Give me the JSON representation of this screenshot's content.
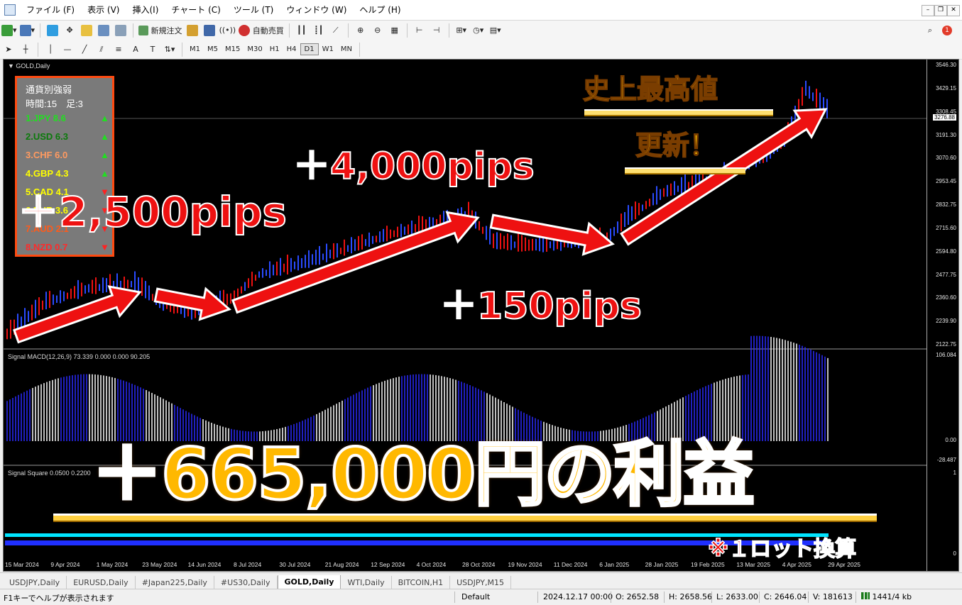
{
  "menu": [
    "ファイル (F)",
    "表示 (V)",
    "挿入(I)",
    "チャート (C)",
    "ツール (T)",
    "ウィンドウ (W)",
    "ヘルプ (H)"
  ],
  "toolbar": {
    "new_order": "新規注文",
    "auto_trade": "自動売買",
    "notification_count": "1"
  },
  "timeframes": [
    "M1",
    "M5",
    "M15",
    "M30",
    "H1",
    "H4",
    "D1",
    "W1",
    "MN"
  ],
  "active_timeframe": "D1",
  "chart": {
    "symbol_label": "GOLD,Daily",
    "price_ticks": [
      "3546.30",
      "3429.15",
      "3308.45",
      "3191.30",
      "3070.60",
      "2953.45",
      "2832.75",
      "2715.60",
      "2594.80",
      "2477.75",
      "2360.60",
      "2239.90",
      "2122.75"
    ],
    "current_price": "3276.88",
    "macd_label": "Signal MACD(12,26,9) 73.339 0.000 0.000 90.205",
    "macd_ticks": [
      "106.084",
      "0.00",
      "-28.487"
    ],
    "square_label": "Signal Square 0.0500 0.2200",
    "square_ticks": [
      "1",
      "0"
    ],
    "dates": [
      "15 Mar 2024",
      "9 Apr 2024",
      "1 May 2024",
      "23 May 2024",
      "14 Jun 2024",
      "8 Jul 2024",
      "30 Jul 2024",
      "21 Aug 2024",
      "12 Sep 2024",
      "4 Oct 2024",
      "28 Oct 2024",
      "19 Nov 2024",
      "11 Dec 2024",
      "6 Jan 2025",
      "28 Jan 2025",
      "19 Feb 2025",
      "13 Mar 2025",
      "4 Apr 2025",
      "29 Apr 2025"
    ]
  },
  "strength": {
    "title": "通貨別強弱",
    "time_line": "時間:15　足:3",
    "rows": [
      {
        "label": "1.JPY",
        "value": "8.6",
        "dir": "▲",
        "color": "#22dd22"
      },
      {
        "label": "2.USD",
        "value": "6.3",
        "dir": "▲",
        "color": "#0a7a0a"
      },
      {
        "label": "3.CHF",
        "value": "6.0",
        "dir": "▲",
        "color": "#ff9a60"
      },
      {
        "label": "4.GBP",
        "value": "4.3",
        "dir": "▲",
        "color": "#ffff00"
      },
      {
        "label": "5.CAD",
        "value": "4.1",
        "dir": "▼",
        "color": "#ffff00"
      },
      {
        "label": "6.EUR",
        "value": "3.6",
        "dir": "▼",
        "color": "#ffff00"
      },
      {
        "label": "7.AUD",
        "value": "2.1",
        "dir": "▼",
        "color": "#ff5a1a"
      },
      {
        "label": "8.NZD",
        "value": "0.7",
        "dir": "▼",
        "color": "#ff2a2a"
      }
    ]
  },
  "overlay": {
    "pips1": "＋2,500pips",
    "pips2": "＋4,000pips",
    "pips3": "＋150pips",
    "record_line1": "史上最高値",
    "record_line2": "更新！",
    "profit": "＋665,000円の利益",
    "note": "※１ロット換算"
  },
  "tabs": [
    "USDJPY,Daily",
    "EURUSD,Daily",
    "#Japan225,Daily",
    "#US30,Daily",
    "GOLD,Daily",
    "WTI,Daily",
    "BITCOIN,H1",
    "USDJPY,M15"
  ],
  "active_tab": "GOLD,Daily",
  "status": {
    "help": "F1キーでヘルプが表示されます",
    "profile": "Default",
    "datetime": "2024.12.17 00:00",
    "open": "O: 2652.58",
    "high": "H: 2658.56",
    "low": "L: 2633.00",
    "close": "C: 2646.04",
    "volume": "V: 181613",
    "traffic": "1441/4 kb"
  },
  "colors": {
    "arrow_red": "#ee1111",
    "gold_text": "#ffcc00",
    "panel_border": "#ff4a10"
  }
}
